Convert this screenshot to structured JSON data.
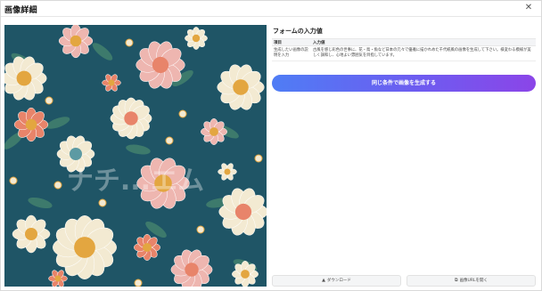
{
  "header": {
    "title": "画像詳細",
    "close_icon": "close-icon"
  },
  "form": {
    "section_title": "フォームの入力値",
    "columns": [
      "項目",
      "入力値"
    ],
    "rows": [
      {
        "item": "生成したい画像の説明を入力",
        "value": "古風を感じ彩色の世事に、花・鳥・魚など日本の元々で優雅に描かれめた千代紙風の画像を生成して下さい。様変わる模様が美しく調和し、心地よい雰囲気を目指しています。"
      }
    ]
  },
  "actions": {
    "generate_label": "同じ条件で画像を生成する",
    "download_label": "ダウンロード",
    "download_icon": "download-icon",
    "open_url_label": "画像URLを開く",
    "open_url_icon": "external-link-icon"
  },
  "image": {
    "watermark": "ナチ...エム",
    "palette": {
      "background": "#1f5566",
      "cream": "#f3ead2",
      "coral": "#e8846a",
      "pink": "#eeb6b0",
      "gold": "#e3a640",
      "teal": "#5d9aa3",
      "leaf": "#3d7a6c"
    }
  }
}
